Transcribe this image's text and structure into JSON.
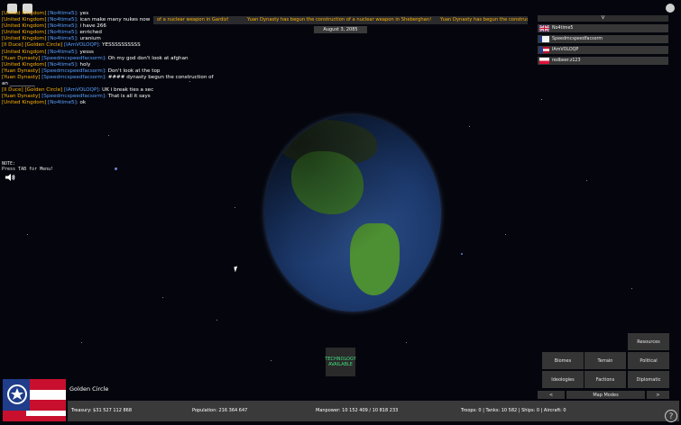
{
  "ticker": {
    "items": [
      "of a nuclear weapon in Gardiz!",
      "Yuan Dynasty has begun the construction of a nuclear weapon in Sheberghan!",
      "Yuan Dynasty has begun the constructi"
    ]
  },
  "date": "August 3, 2085",
  "chat": [
    {
      "tag1": "[United Kingdom]",
      "tag2": "[No4time5]:",
      "msg": "yes"
    },
    {
      "tag1": "[United Kingdom]",
      "tag2": "[No4time5]:",
      "msg": "ican make many nukes now"
    },
    {
      "tag1": "[United Kingdom]",
      "tag2": "[No4time5]:",
      "msg": "i have 266"
    },
    {
      "tag1": "[United Kingdom]",
      "tag2": "[No4time5]:",
      "msg": "enriched"
    },
    {
      "tag1": "[United Kingdom]",
      "tag2": "[No4time5]:",
      "msg": "uranium"
    },
    {
      "tag1": "[Il Duce] [Golden Circle]",
      "tag2": "[IAmVOLOQP]:",
      "msg": "YESSSSSSSSSS"
    },
    {
      "tag1": "[United Kingdom]",
      "tag2": "[No4time5]:",
      "msg": "yesss"
    },
    {
      "tag1": "[Yuan Dynasty]",
      "tag2": "[Speedmcspeedfacsorm]:",
      "msg": "Oh my god don't look at afghan"
    },
    {
      "tag1": "[United Kingdom]",
      "tag2": "[No4time5]:",
      "msg": "holy"
    },
    {
      "tag1": "[Yuan Dynasty]",
      "tag2": "[Speedmcspeedfacsorm]:",
      "msg": "Don't look at the top"
    },
    {
      "tag1": "[Yuan Dynasty]",
      "tag2": "[Speedmcspeedfacsorm]:",
      "msg": "#### dynasty begun the construction of"
    },
    {
      "tag1": "",
      "tag2": "",
      "msg": "an __________"
    },
    {
      "tag1": "[Il Duce] [Golden Circle]",
      "tag2": "[IAmVOLOQP]:",
      "msg": "UK i break ties a sec"
    },
    {
      "tag1": "[Yuan Dynasty]",
      "tag2": "[Speedmcspeedfacsorm]:",
      "msg": "That is all it says"
    },
    {
      "tag1": "[United Kingdom]",
      "tag2": "[No4time5]:",
      "msg": "ok"
    }
  ],
  "note": {
    "line1": "NOTE:",
    "line2": "Press TAB for Menu!"
  },
  "players": {
    "header": "V",
    "list": [
      {
        "name": "No4time5",
        "flag": "uk-flag"
      },
      {
        "name": "Speedmcspeedfacsorm",
        "flag": "white-flag"
      },
      {
        "name": "IAmVOLOQP",
        "flag": "golden-circle-flag"
      },
      {
        "name": "redbeer.z123",
        "flag": "poland-flag"
      }
    ]
  },
  "tech": {
    "line1": "TECHNOLOGY",
    "line2": "AVAILABLE"
  },
  "mapmodes": {
    "resources": "Resources",
    "biomes": "Biomes",
    "terrain": "Terrain",
    "political": "Political",
    "ideologies": "Ideologies",
    "factions": "Factions",
    "diplomatic": "Diplomatic",
    "prev": "<",
    "label": "Map Modes",
    "next": ">"
  },
  "country": {
    "name": "Golden Circle"
  },
  "stats": {
    "treasury": "Treasury:  $31 527 112 868",
    "population": "Population: 216 364 647",
    "manpower": "Manpower:  10 152 409  /  10 818 233",
    "military": "Troops: 0  |  Tanks: 10 582  |  Ships: 0  |  Aircraft: 0"
  },
  "colors": {
    "tag_nation": "#ffb300",
    "tag_player": "#5aa0ff",
    "tech_text": "#3fe27f"
  }
}
